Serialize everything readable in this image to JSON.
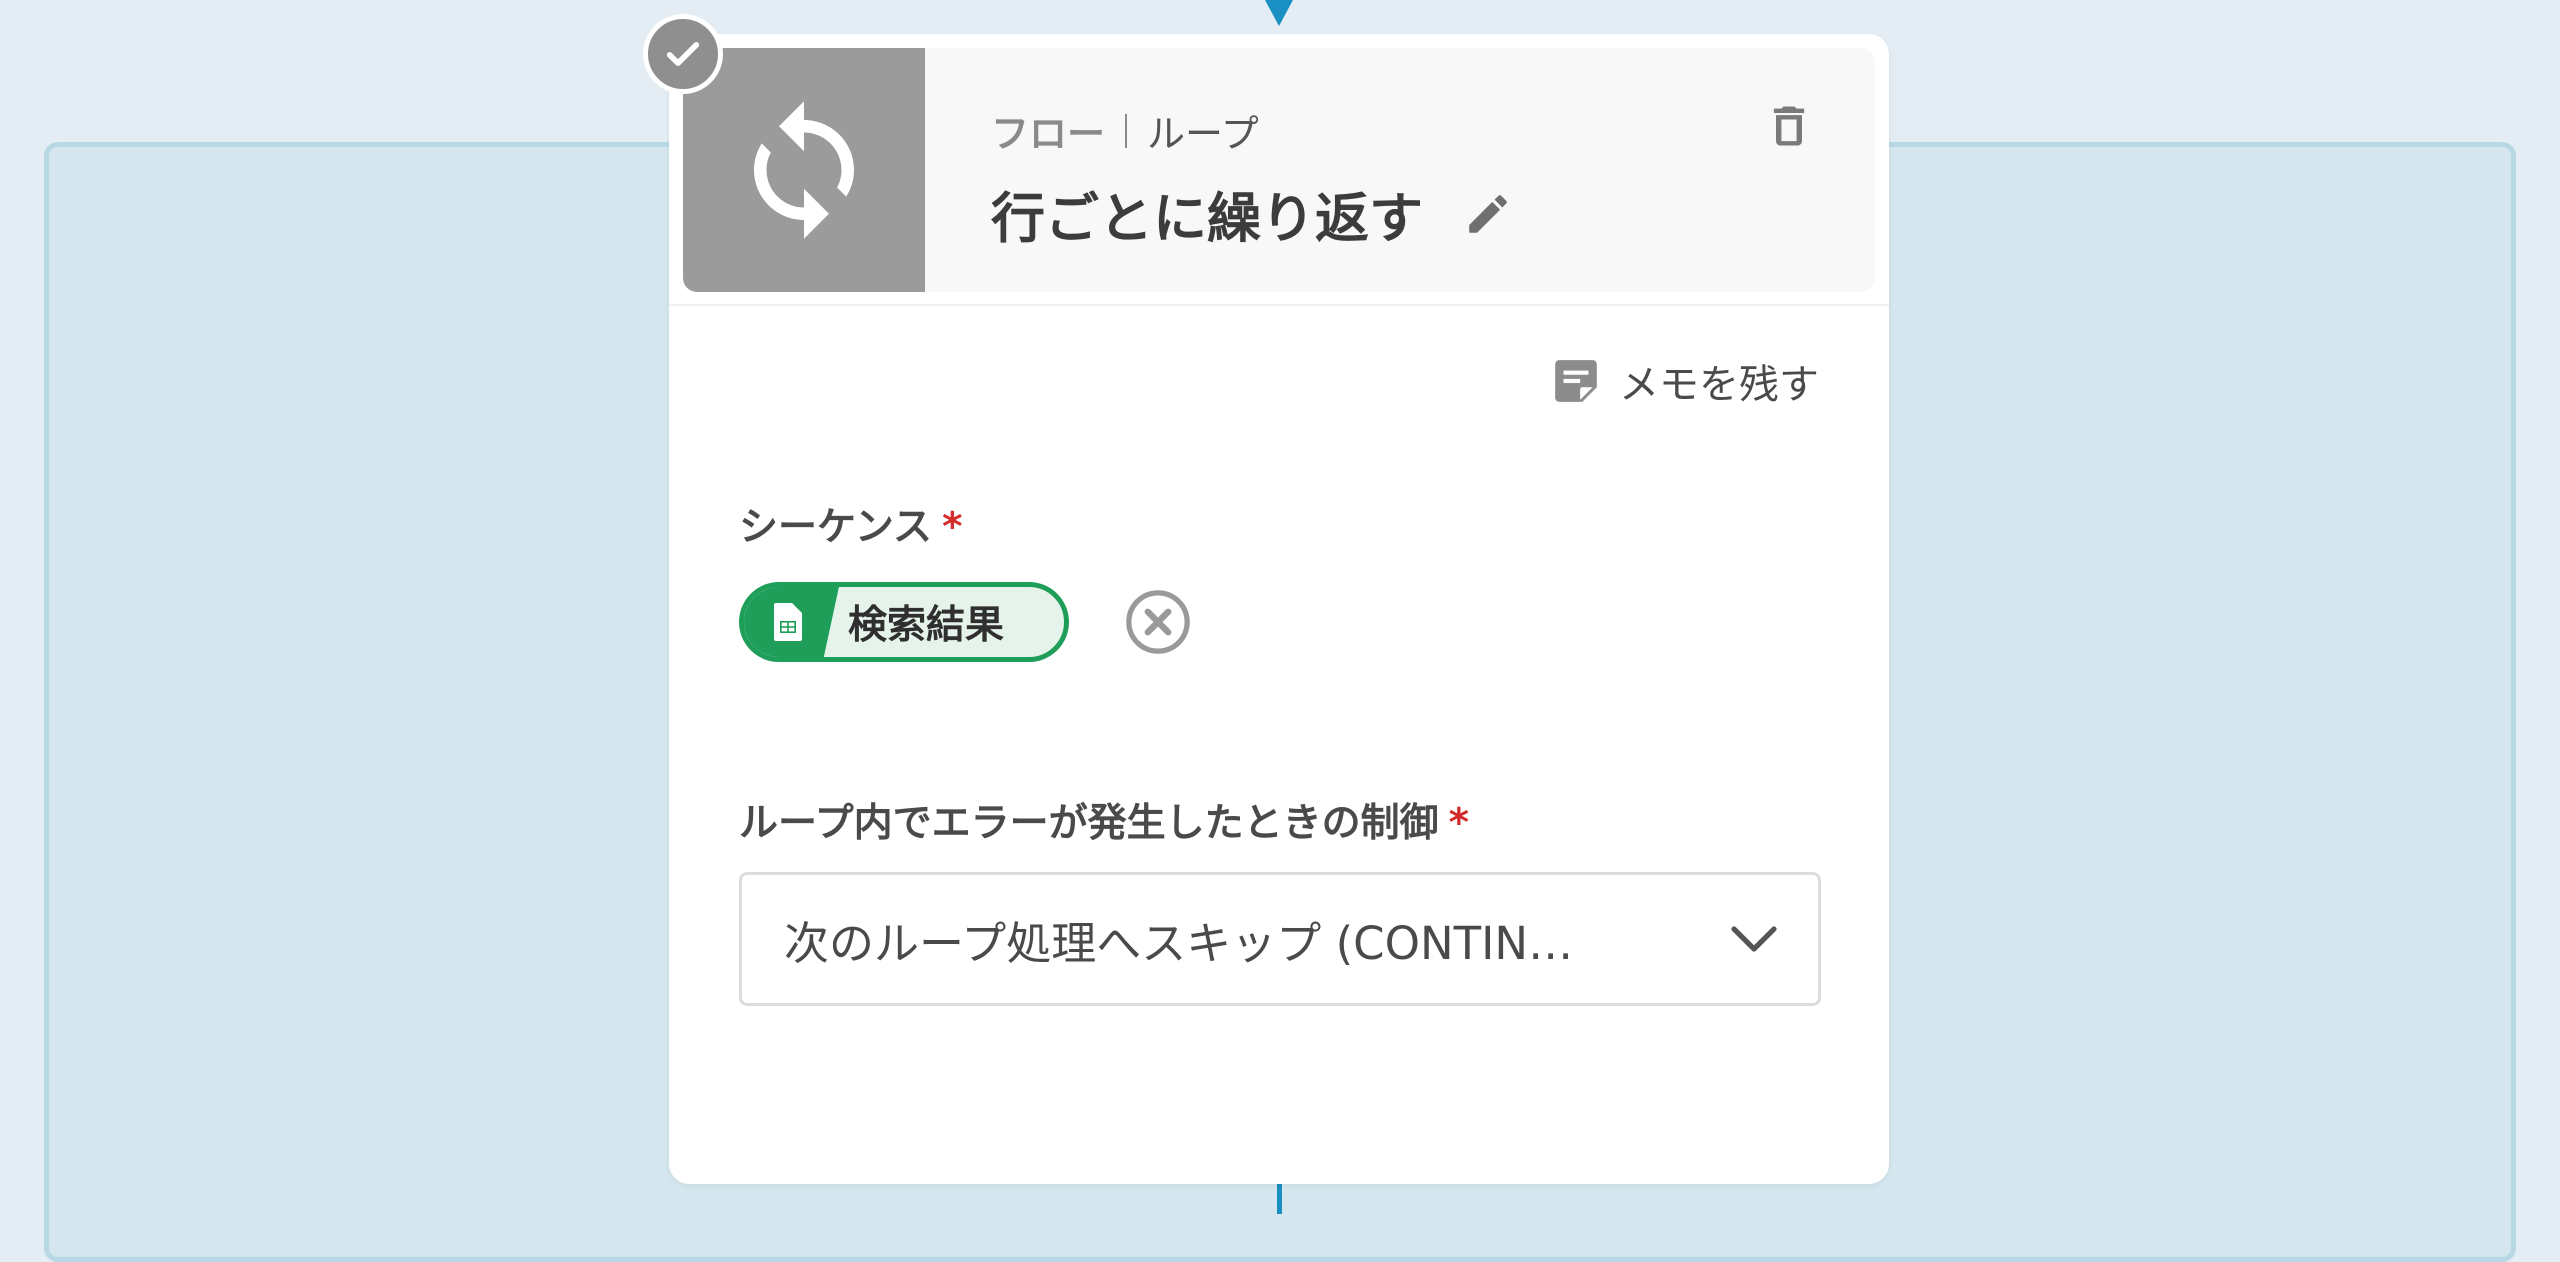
{
  "colors": {
    "accent": "#1a8fc1",
    "chip_green": "#1e9e59",
    "required": "#d42a2a",
    "icon_gray": "#9b9b9b"
  },
  "card": {
    "category": "フロー",
    "subcategory": "ループ",
    "title": "行ごとに繰り返す",
    "icon": "loop-icon",
    "delete_icon": "trash-icon",
    "edit_icon": "pencil-icon",
    "status_icon": "check-icon"
  },
  "memo": {
    "label": "メモを残す",
    "icon": "memo-icon"
  },
  "sequence": {
    "label": "シーケンス",
    "required_mark": "*",
    "chip_label": "検索結果",
    "chip_icon": "spreadsheet-icon",
    "clear_icon": "clear-circle-icon"
  },
  "error_control": {
    "label": "ループ内でエラーが発生したときの制御",
    "required_mark": "*",
    "selected": "次のループ処理へスキップ (CONTIN…",
    "dropdown_icon": "chevron-down-icon"
  }
}
